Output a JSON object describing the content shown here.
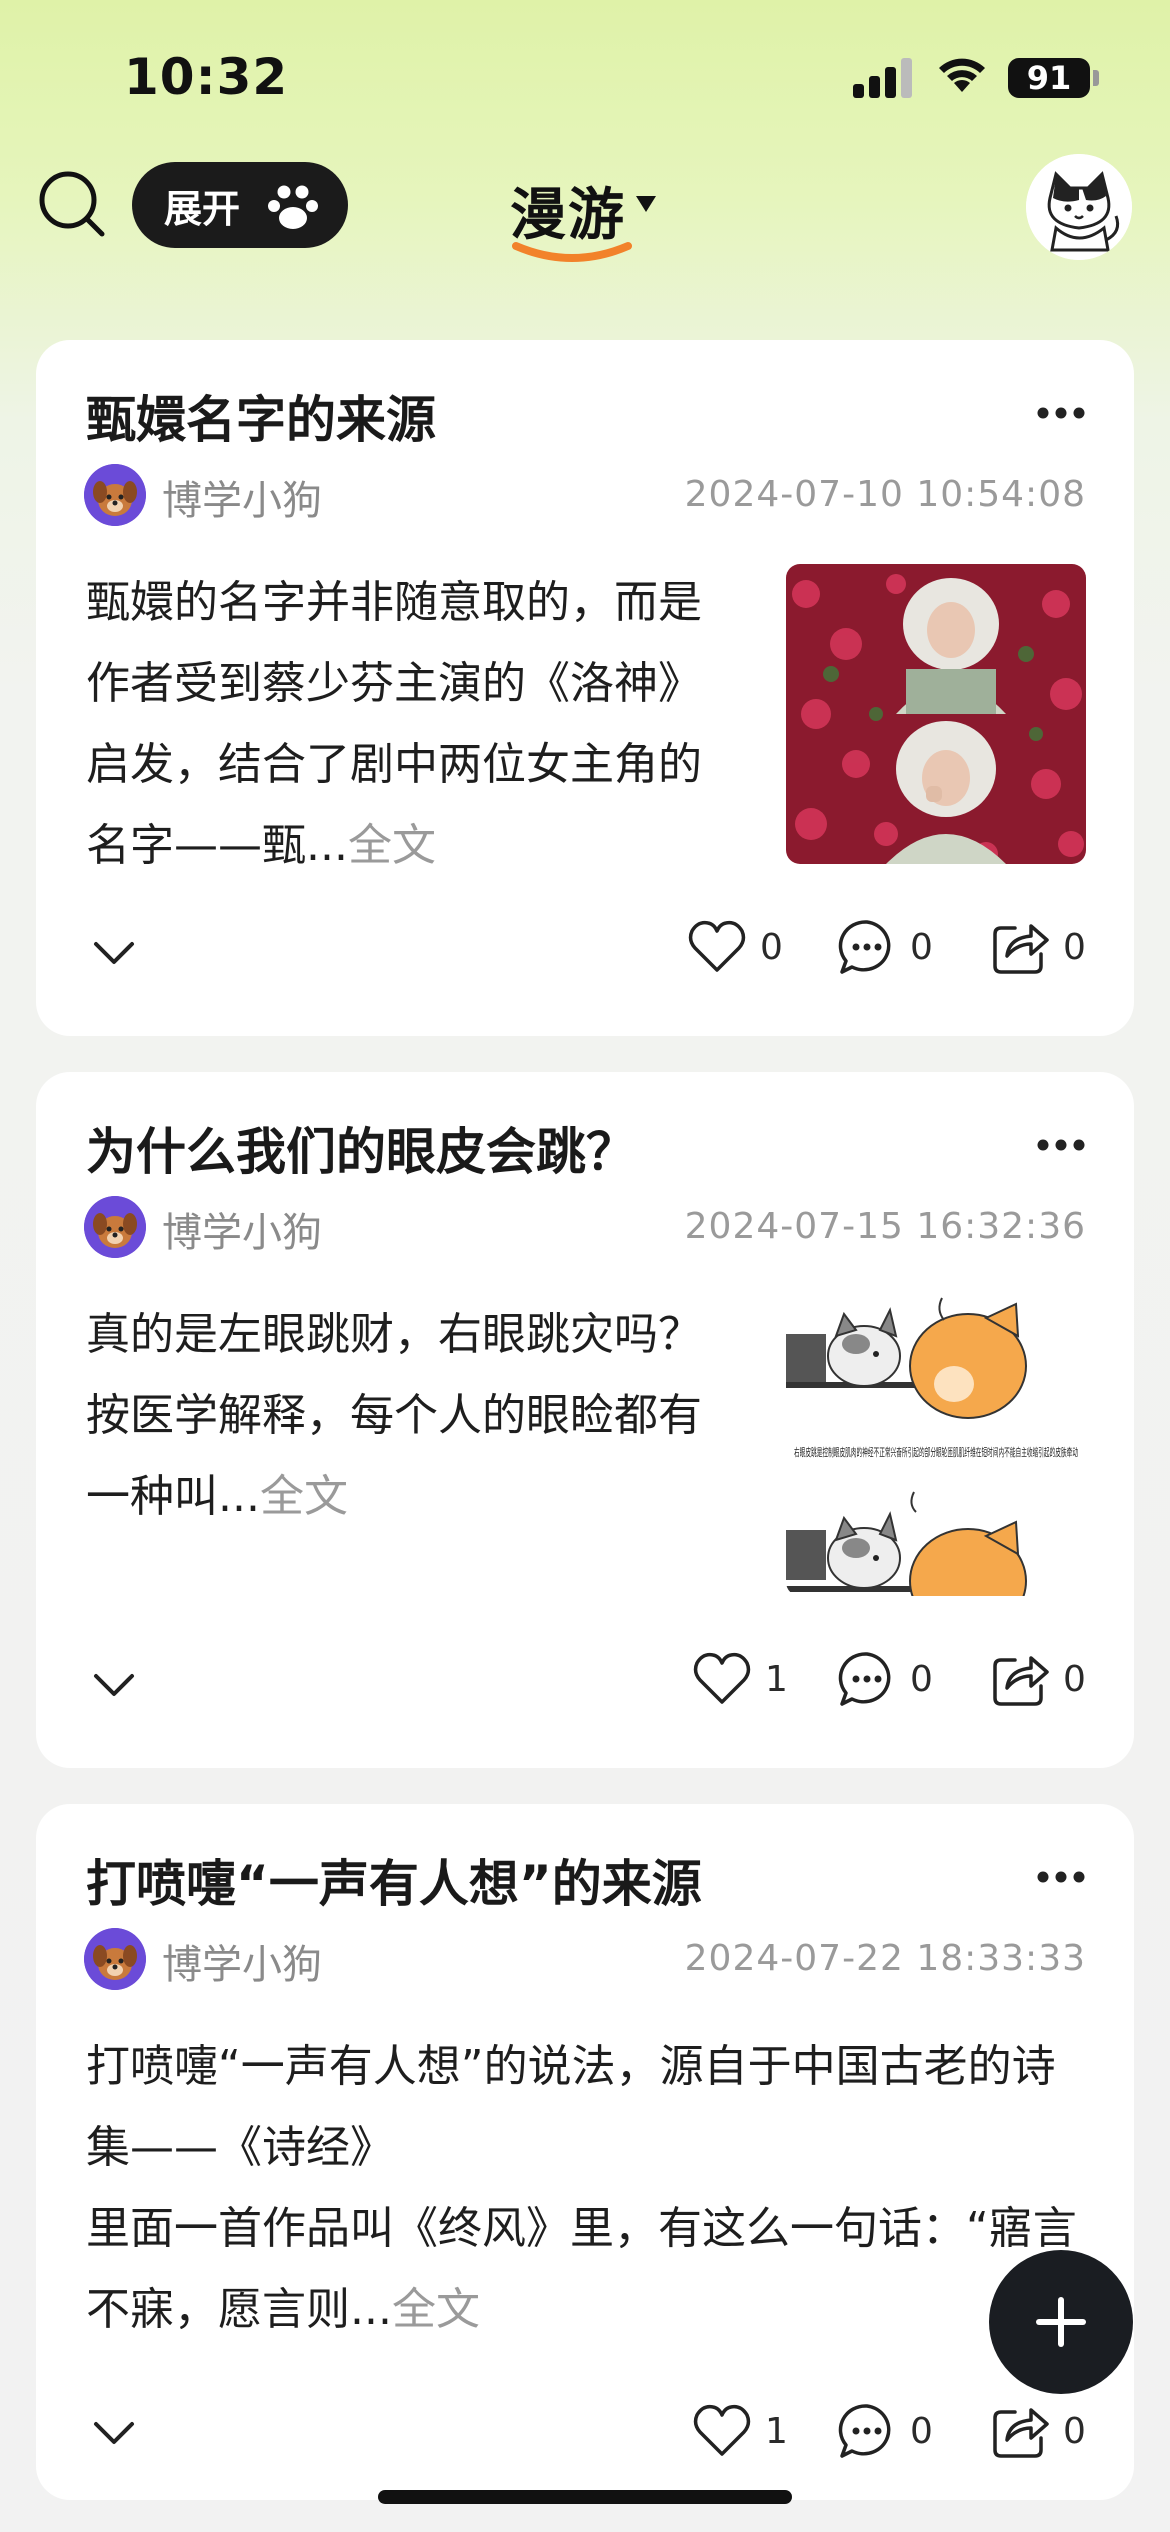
{
  "status_bar": {
    "time": "10:32",
    "battery": "91"
  },
  "header": {
    "expand_label": "展开",
    "title": "漫游"
  },
  "posts": [
    {
      "title": "甄嬛名字的来源",
      "author": "博学小狗",
      "time": "2024-07-10 10:54:08",
      "body": "甄嬛的名字并非随意取的，而是作者受到蔡少芬主演的《洛神》启发，结合了剧中两位女主角的名字——甄...",
      "read_more": "全文",
      "likes": "0",
      "comments": "0",
      "shares": "0"
    },
    {
      "title": "为什么我们的眼皮会跳？",
      "author": "博学小狗",
      "time": "2024-07-15 16:32:36",
      "body_line1": "真的是左眼跳财，右眼跳灾吗？",
      "body_line2": "按医学解释，每个人的眼睑都有一种叫...",
      "read_more": "全文",
      "thumb_caption": "右眼皮跳是控制眼皮肌肉的神经不正常兴奋所引起的部分眼轮匝肌肌纤维在短时间内不能自主收缩引起的皮肤牵动",
      "likes": "1",
      "comments": "0",
      "shares": "0"
    },
    {
      "title": "打喷嚏“一声有人想”的来源",
      "author": "博学小狗",
      "time": "2024-07-22 18:33:33",
      "body_line1": "打喷嚏“一声有人想”的说法，源自于中国古老的诗集——《诗经》",
      "body_line2": "里面一首作品叫《终风》里，有这么一句话：“寤言不寐，愿言则...",
      "read_more": "全文",
      "likes": "1",
      "comments": "0",
      "shares": "0"
    }
  ],
  "colors": {
    "accent_orange": "#f2822a",
    "dark": "#1b1b1b",
    "muted_text": "#8a8a8a"
  }
}
